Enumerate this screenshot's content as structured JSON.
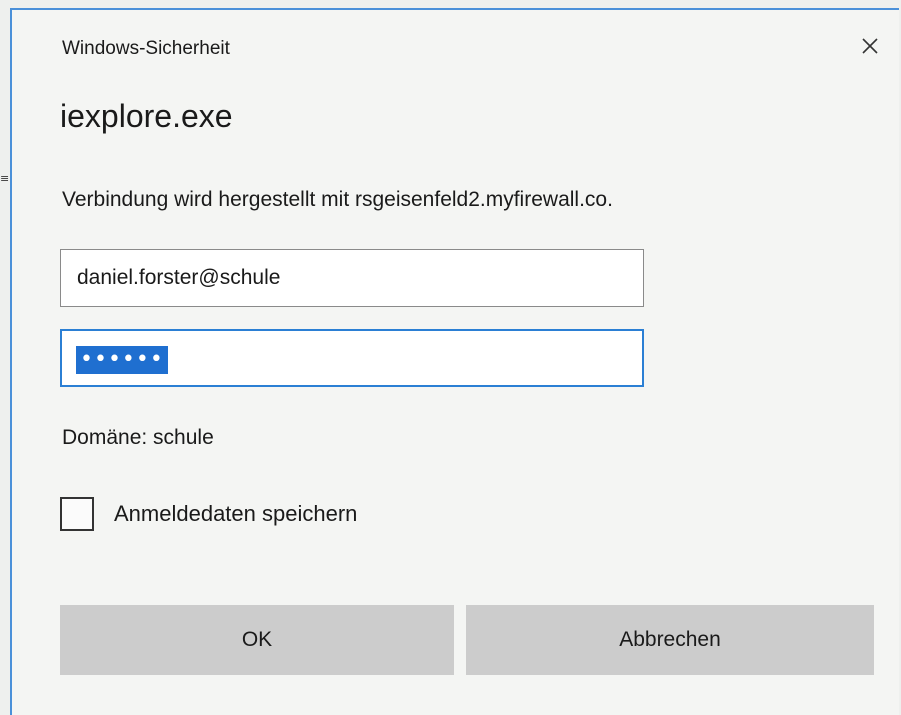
{
  "window": {
    "title": "Windows-Sicherheit",
    "close_icon": "close-icon"
  },
  "app_title": "iexplore.exe",
  "message": "Verbindung wird hergestellt mit rsgeisenfeld2.myfirewall.co.",
  "username_field": {
    "value": "daniel.forster@schule"
  },
  "password_field": {
    "masked_value": "••••••",
    "selected": true
  },
  "domain_text": "Domäne: schule",
  "remember": {
    "label": "Anmeldedaten speichern",
    "checked": false
  },
  "buttons": {
    "ok": "OK",
    "cancel": "Abbrechen"
  },
  "colors": {
    "accent": "#2b7fd4",
    "selection": "#1f6fd0",
    "button_bg": "#cccccc",
    "dialog_bg": "#f4f5f3"
  }
}
